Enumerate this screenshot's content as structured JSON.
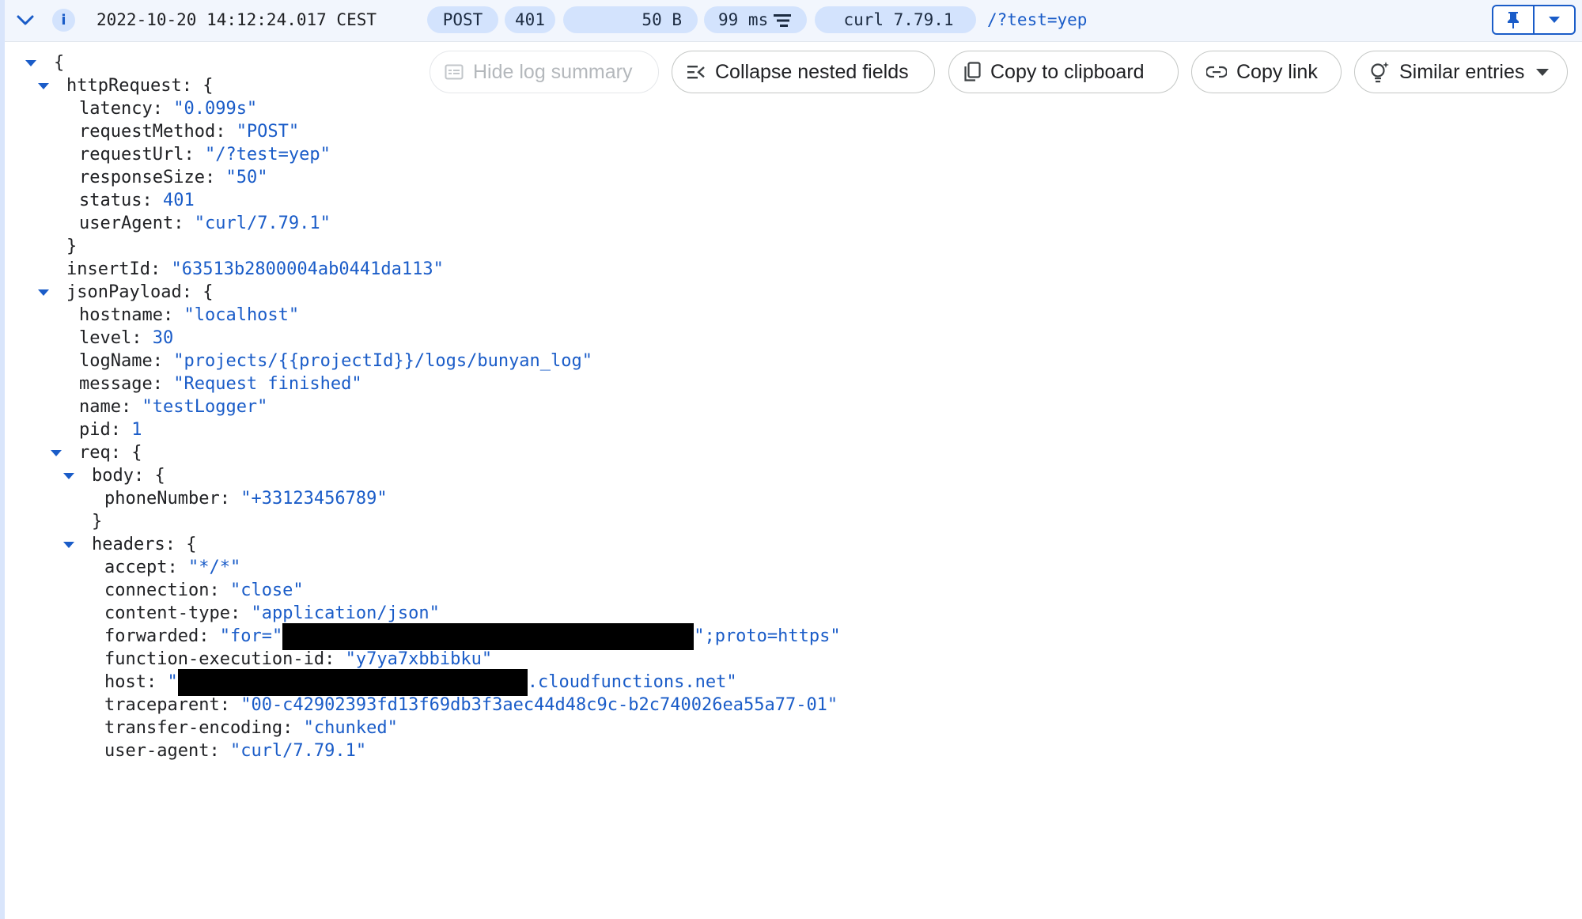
{
  "summary": {
    "timestamp": "2022-10-20 14:12:24.017 CEST",
    "method": "POST",
    "status": "401",
    "size": "50 B",
    "latency": "99 ms",
    "user_agent": "curl 7.79.1",
    "url": "/?test=yep",
    "info_icon": "i"
  },
  "actions": {
    "hide_summary": "Hide log summary",
    "collapse": "Collapse nested fields",
    "copy": "Copy to clipboard",
    "link": "Copy link",
    "similar": "Similar entries"
  },
  "json": {
    "open_brace": "{",
    "httpRequest": {
      "key": "httpRequest",
      "latency": {
        "key": "latency",
        "value": "\"0.099s\""
      },
      "requestMethod": {
        "key": "requestMethod",
        "value": "\"POST\""
      },
      "requestUrl": {
        "key": "requestUrl",
        "value": "\"/?test=yep\""
      },
      "responseSize": {
        "key": "responseSize",
        "value": "\"50\""
      },
      "status": {
        "key": "status",
        "value": "401"
      },
      "userAgent": {
        "key": "userAgent",
        "value": "\"curl/7.79.1\""
      }
    },
    "insertId": {
      "key": "insertId",
      "value": "\"63513b2800004ab0441da113\""
    },
    "jsonPayload": {
      "key": "jsonPayload",
      "hostname": {
        "key": "hostname",
        "value": "\"localhost\""
      },
      "level": {
        "key": "level",
        "value": "30"
      },
      "logName": {
        "key": "logName",
        "value": "\"projects/{{projectId}}/logs/bunyan_log\""
      },
      "message": {
        "key": "message",
        "value": "\"Request finished\""
      },
      "name": {
        "key": "name",
        "value": "\"testLogger\""
      },
      "pid": {
        "key": "pid",
        "value": "1"
      },
      "req": {
        "key": "req",
        "body": {
          "key": "body",
          "phoneNumber": {
            "key": "phoneNumber",
            "value": "\"+33123456789\""
          }
        },
        "headers": {
          "key": "headers",
          "accept": {
            "key": "accept",
            "value": "\"*/*\""
          },
          "connection": {
            "key": "connection",
            "value": "\"close\""
          },
          "content_type": {
            "key": "content-type",
            "value": "\"application/json\""
          },
          "forwarded": {
            "key": "forwarded",
            "value_prefix": "\"for=\"",
            "value_suffix": "\";proto=https\""
          },
          "function_execution_id": {
            "key": "function-execution-id",
            "value": "\"y7ya7xbbibku\""
          },
          "host": {
            "key": "host",
            "value_prefix": "\"",
            "value_suffix": ".cloudfunctions.net\""
          },
          "traceparent": {
            "key": "traceparent",
            "value": "\"00-c42902393fd13f69db3f3aec44d48c9c-b2c740026ea55a77-01\""
          },
          "transfer_encoding": {
            "key": "transfer-encoding",
            "value": "\"chunked\""
          },
          "user_agent": {
            "key": "user-agent",
            "value": "\"curl/7.79.1\""
          }
        }
      }
    }
  }
}
